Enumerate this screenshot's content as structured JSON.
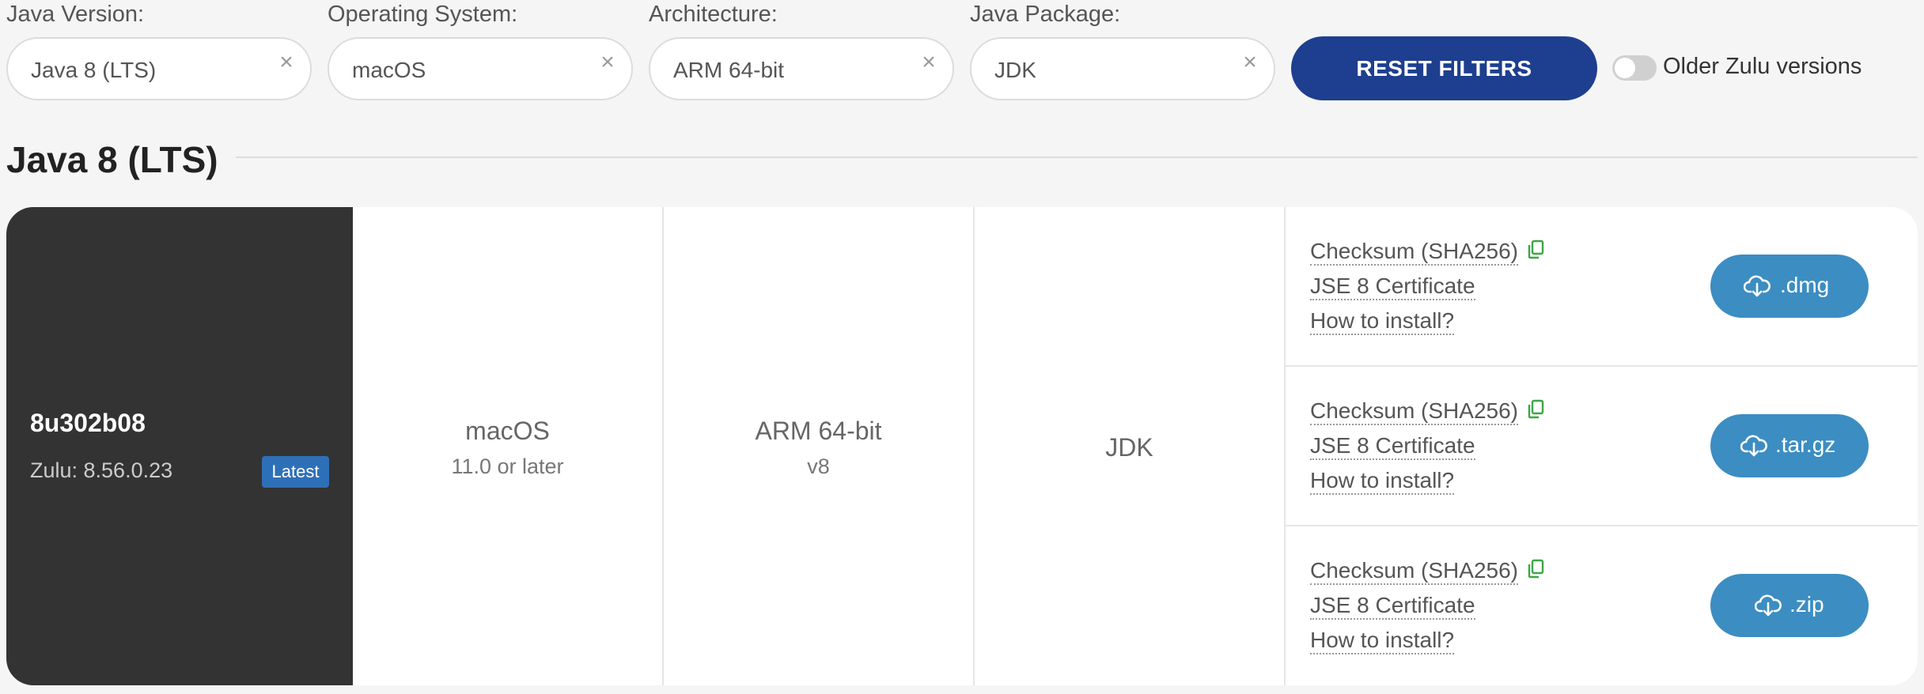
{
  "filters": {
    "java_version": {
      "label": "Java Version:",
      "value": "Java 8 (LTS)",
      "clear": "×"
    },
    "operating_system": {
      "label": "Operating System:",
      "value": "macOS",
      "clear": "×"
    },
    "architecture": {
      "label": "Architecture:",
      "value": "ARM 64-bit",
      "clear": "×"
    },
    "java_package": {
      "label": "Java Package:",
      "value": "JDK",
      "clear": "×"
    },
    "reset_label": "RESET FILTERS",
    "older_versions": {
      "label": "Older Zulu versions",
      "checked": false
    }
  },
  "section": {
    "title": "Java 8 (LTS)"
  },
  "release": {
    "version": "8u302b08",
    "zulu": "Zulu: 8.56.0.23",
    "badge": "Latest",
    "os": {
      "name": "macOS",
      "detail": "11.0 or later"
    },
    "arch": {
      "name": "ARM 64-bit",
      "detail": "v8"
    },
    "package": "JDK",
    "downloads": [
      {
        "checksum": "Checksum (SHA256)",
        "certificate": "JSE 8 Certificate",
        "install": "How to install?",
        "button": ".dmg",
        "icon": "cloud-download-icon"
      },
      {
        "checksum": "Checksum (SHA256)",
        "certificate": "JSE 8 Certificate",
        "install": "How to install?",
        "button": ".tar.gz",
        "icon": "cloud-download-icon"
      },
      {
        "checksum": "Checksum (SHA256)",
        "certificate": "JSE 8 Certificate",
        "install": "How to install?",
        "button": ".zip",
        "icon": "cloud-download-icon"
      }
    ]
  },
  "colors": {
    "accent": "#1e3f8f",
    "download": "#3c8dc2",
    "copy_icon": "#3aa645",
    "version_panel": "#333333",
    "badge": "#2e70b8"
  }
}
